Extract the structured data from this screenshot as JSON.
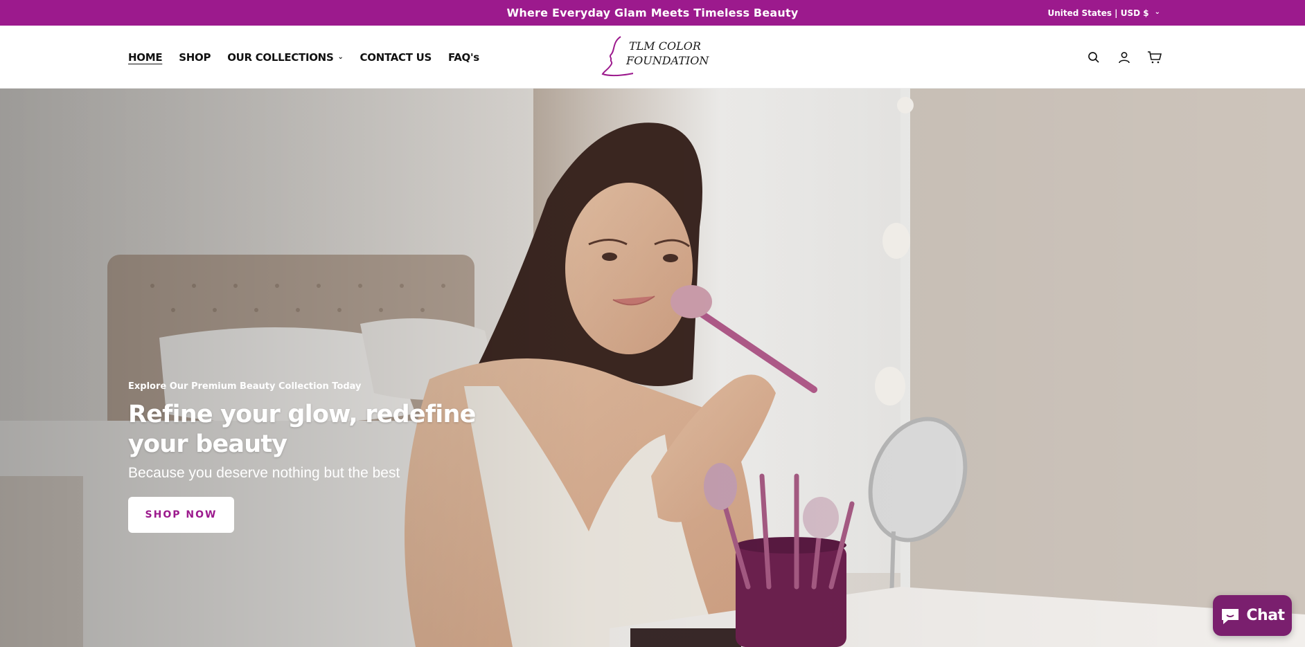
{
  "announcement": {
    "text": "Where Everyday Glam Meets Timeless Beauty"
  },
  "localization": {
    "label": "United States | USD $"
  },
  "nav": {
    "items": [
      {
        "label": "HOME"
      },
      {
        "label": "SHOP"
      },
      {
        "label": "OUR COLLECTIONS"
      },
      {
        "label": "CONTACT US"
      },
      {
        "label": "FAQ's"
      }
    ]
  },
  "logo": {
    "line1": "TLM COLOR",
    "line2": "FOUNDATION"
  },
  "hero": {
    "eyebrow": "Explore Our Premium Beauty Collection Today",
    "title": "Refine your glow, redefine your beauty",
    "subtitle": "Because you deserve nothing but the best",
    "cta": "SHOP NOW"
  },
  "chat": {
    "label": "Chat"
  },
  "colors": {
    "brand": "#9c1a8d",
    "chat": "#7a1f6e"
  }
}
